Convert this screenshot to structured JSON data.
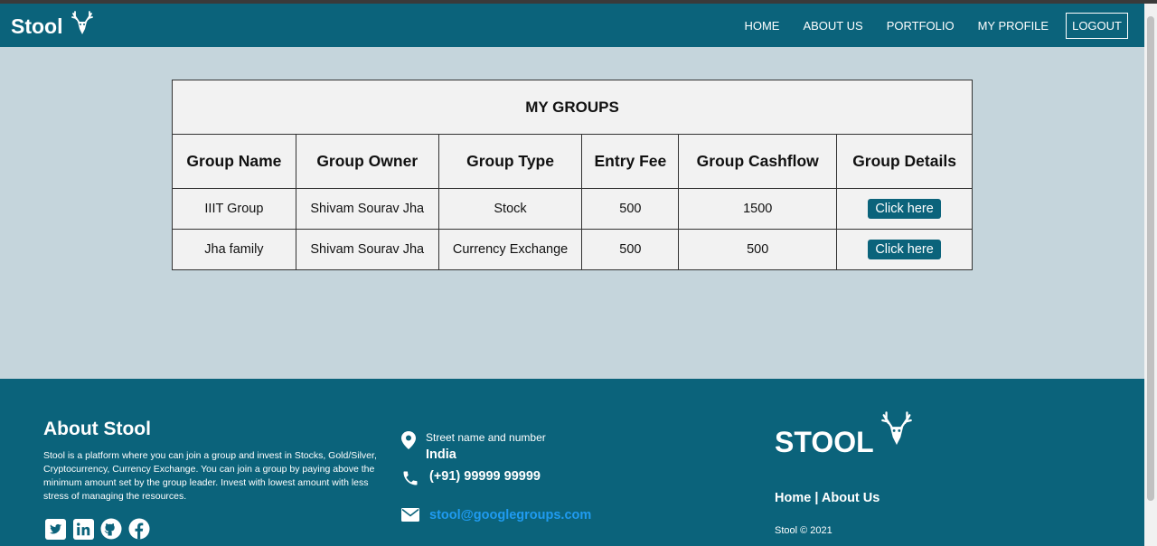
{
  "nav": {
    "brand": "Stool",
    "links": [
      "HOME",
      "ABOUT US",
      "PORTFOLIO",
      "MY PROFILE"
    ],
    "logout": "LOGOUT"
  },
  "table": {
    "title": "MY GROUPS",
    "headers": [
      "Group Name",
      "Group Owner",
      "Group Type",
      "Entry Fee",
      "Group Cashflow",
      "Group Details"
    ],
    "rows": [
      {
        "name": "IIIT Group",
        "owner": "Shivam Sourav Jha",
        "type": "Stock",
        "fee": "500",
        "cashflow": "1500",
        "action": "Click here"
      },
      {
        "name": "Jha family",
        "owner": "Shivam Sourav Jha",
        "type": "Currency Exchange",
        "fee": "500",
        "cashflow": "500",
        "action": "Click here"
      }
    ]
  },
  "footer": {
    "about_title": "About Stool",
    "about_text": "Stool is a platform where you can join a group and invest in Stocks, Gold/Silver, Cryptocurrency, Currency Exchange. You can join a group by paying above the minimum amount set by the group leader. Invest with lowest amount with less stress of managing the resources.",
    "street": "Street name and number",
    "country": "India",
    "phone": "(+91) 99999 99999",
    "email": "stool@googlegroups.com",
    "brand": "STOOL",
    "link_home": "Home",
    "link_separator": "|",
    "link_about": "About Us",
    "copyright": "Stool © 2021"
  },
  "colors": {
    "primary": "#0b637b",
    "background": "#c5d5dc",
    "table_bg": "#f2f2f2",
    "email_link": "#1f9bf0"
  }
}
